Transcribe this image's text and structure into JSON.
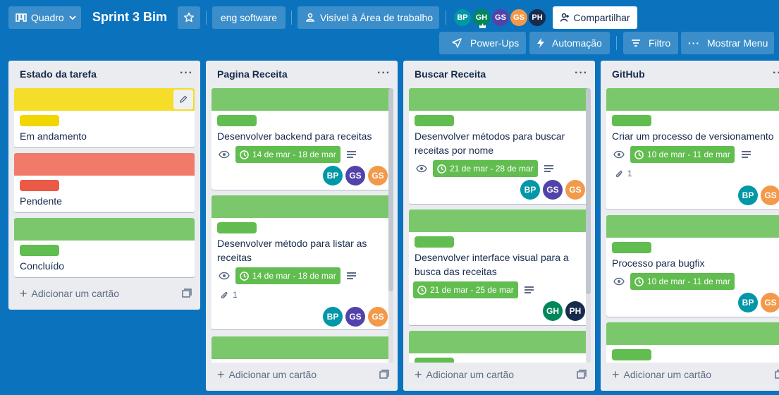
{
  "header": {
    "view_label": "Quadro",
    "board_title": "Sprint 3 Bim",
    "workspace": "eng software",
    "visibility": "Visível à Área de trabalho",
    "share_label": "Compartilhar",
    "members": [
      {
        "initials": "BP",
        "color": "#0097a7"
      },
      {
        "initials": "GH",
        "color": "#00875a"
      },
      {
        "initials": "GS",
        "color": "#5243aa"
      },
      {
        "initials": "GS",
        "color": "#f2994a"
      },
      {
        "initials": "PH",
        "color": "#172b4d"
      }
    ],
    "powerups_label": "Power-Ups",
    "automation_label": "Automação",
    "filter_label": "Filtro",
    "menu_label": "Mostrar Menu"
  },
  "colors": {
    "green": "#61bd4f",
    "cover_green": "#7bc86c",
    "yellow": "#f5dd29",
    "yellow_label": "#f2d600",
    "red": "#f27a6a",
    "red_label": "#eb5a46"
  },
  "lists": [
    {
      "title": "Estado da tarefa",
      "add_label": "Adicionar um cartão",
      "cards": [
        {
          "title": "Em andamento"
        },
        {
          "title": "Pendente"
        },
        {
          "title": "Concluído"
        }
      ]
    },
    {
      "title": "Pagina Receita",
      "add_label": "Adicionar um cartão",
      "cards": [
        {
          "title": "Desenvolver backend para receitas",
          "due": "14 de mar - 18 de mar",
          "members": [
            "BP",
            "GS",
            "GS"
          ]
        },
        {
          "title": "Desenvolver método para listar as receitas",
          "due": "14 de mar - 18 de mar",
          "attachments": "1",
          "members": [
            "BP",
            "GS",
            "GS"
          ]
        }
      ]
    },
    {
      "title": "Buscar Receita",
      "add_label": "Adicionar um cartão",
      "cards": [
        {
          "title": "Desenvolver métodos para buscar receitas por nome",
          "due": "21 de mar - 28 de mar",
          "members": [
            "BP",
            "GS",
            "GS"
          ]
        },
        {
          "title": "Desenvolver interface visual para a busca das receitas",
          "due": "21 de mar - 25 de mar",
          "members": [
            "GH",
            "PH"
          ]
        }
      ]
    },
    {
      "title": "GitHub",
      "add_label": "Adicionar um cartão",
      "cards": [
        {
          "title": "Criar um processo de versionamento",
          "due": "10 de mar - 11 de mar",
          "attachments": "1",
          "members": [
            "BP",
            "GS"
          ]
        },
        {
          "title": "Processo para bugfix",
          "due": "10 de mar - 11 de mar",
          "members": [
            "BP",
            "GS"
          ]
        }
      ]
    }
  ],
  "member_colors": {
    "BP": "#0097a7",
    "GS1": "#5243aa",
    "GS2": "#f2994a",
    "GH": "#00875a",
    "PH": "#172b4d"
  }
}
